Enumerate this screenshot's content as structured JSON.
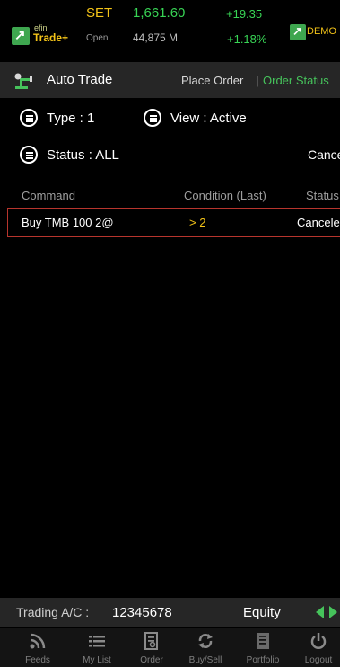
{
  "header": {
    "logo_small": "efin",
    "logo_main": "Trade+",
    "index_name": "SET",
    "market_state": "Open",
    "index_value": "1,661.60",
    "volume": "44,875 M",
    "change": "+19.35",
    "change_pct": "+1.18%",
    "mode_badge": "DEMO"
  },
  "titlebar": {
    "title": "Auto Trade",
    "place_order": "Place Order",
    "separator": "|",
    "order_status": "Order Status"
  },
  "filters": {
    "type_label": "Type : 1",
    "view_label": "View : Active",
    "status_label": "Status : ALL",
    "cancel_label": "Cancel"
  },
  "table": {
    "headers": {
      "command": "Command",
      "condition": "Condition (Last)",
      "status": "Status"
    },
    "rows": [
      {
        "command": "Buy TMB 100 2@",
        "condition": "> 2",
        "status": "Canceled"
      }
    ]
  },
  "account": {
    "label": "Trading A/C :",
    "number": "12345678",
    "type": "Equity"
  },
  "nav": [
    {
      "label": "Feeds",
      "icon": "rss-icon"
    },
    {
      "label": "My List",
      "icon": "list-icon"
    },
    {
      "label": "Order",
      "icon": "order-doc-icon"
    },
    {
      "label": "Buy/Sell",
      "icon": "exchange-icon"
    },
    {
      "label": "Portfolio",
      "icon": "portfolio-icon"
    },
    {
      "label": "Logout",
      "icon": "power-icon"
    }
  ],
  "colors": {
    "accent_green": "#46c35b",
    "accent_yellow": "#f3c318",
    "row_border": "#b8352d",
    "bar_bg": "#262626"
  }
}
